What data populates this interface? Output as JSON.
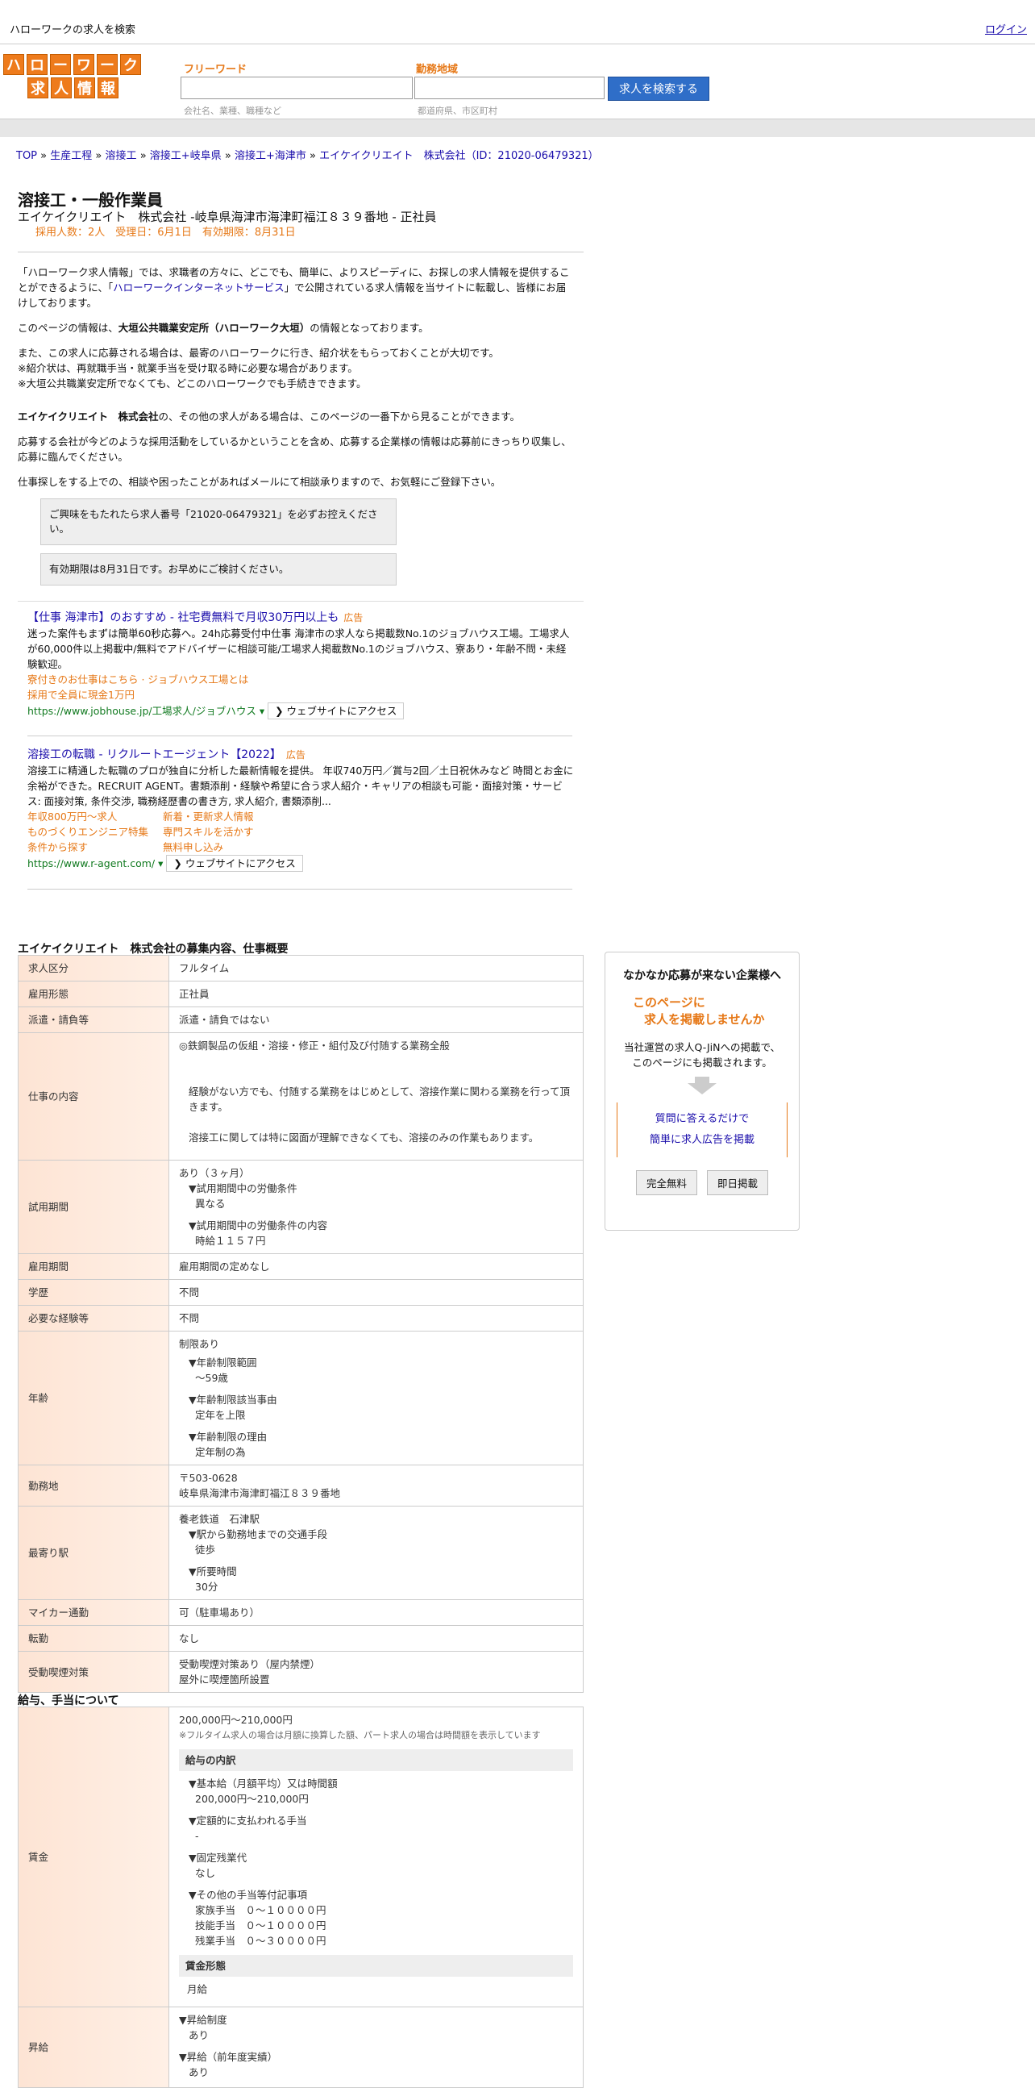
{
  "topbar": {
    "site_title": "ハローワークの求人を検索",
    "login": "ログイン"
  },
  "logo": {
    "row1": [
      "ハ",
      "ロ",
      "ー",
      "ワ",
      "ー",
      "ク"
    ],
    "row2": [
      "求",
      "人",
      "情",
      "報"
    ]
  },
  "search": {
    "freeword_label": "フリーワード",
    "freeword_hint": "会社名、業種、職種など",
    "area_label": "勤務地域",
    "area_hint": "都道府県、市区町村",
    "button": "求人を検索する"
  },
  "breadcrumb": {
    "items": [
      "TOP",
      "生産工程",
      "溶接工",
      "溶接工+岐阜県",
      "溶接工+海津市",
      "エイケイクリエイト　株式会社（ID：21020-06479321）"
    ],
    "sep": "»"
  },
  "job": {
    "title": "溶接工・一般作業員",
    "company_line": "エイケイクリエイト　株式会社 -岐阜県海津市海津町福江８３９番地 - 正社員",
    "meta": "採用人数：2人　受理日：6月1日　有効期限：8月31日"
  },
  "intro": {
    "p1a": "「ハローワーク求人情報」では、求職者の方々に、どこでも、簡単に、よりスピーディに、お探しの求人情報を提供することができるように、「",
    "p1_link": "ハローワークインターネットサービス",
    "p1b": "」で公開されている求人情報を当サイトに転載し、皆様にお届けしております。",
    "p2a": "このページの情報は、",
    "p2_bold": "大垣公共職業安定所（ハローワーク大垣）",
    "p2b": "の情報となっております。",
    "p3_1": "また、この求人に応募される場合は、最寄のハローワークに行き、紹介状をもらっておくことが大切です。",
    "p3_2": "※紹介状は、再就職手当・就業手当を受け取る時に必要な場合があります。",
    "p3_3": "※大垣公共職業安定所でなくても、どこのハローワークでも手続きできます。",
    "p4_bold": "エイケイクリエイト　株式会社",
    "p4": "の、その他の求人がある場合は、このページの一番下から見ることができます。",
    "p5": "応募する会社が今どのような採用活動をしているかということを含め、応募する企業様の情報は応募前にきっちり収集し、応募に臨んでください。",
    "p6": "仕事探しをする上での、相談や困ったことがあればメールにて相談承りますので、お気軽にご登録下さい。"
  },
  "notices": {
    "n1": "ご興味をもたれたら求人番号「21020-06479321」を必ずお控えください。",
    "n2": "有効期限は8月31日です。お早めにご検討ください。"
  },
  "ads": [
    {
      "title": "【仕事 海津市】のおすすめ - 社宅費無料で月収30万円以上も",
      "badge": "広告",
      "body": "迷った案件もまずは簡単60秒応募へ。24h応募受付中仕事 海津市の求人なら掲載数No.1のジョブハウス工場。工場求人が60,000件以上掲載中/無料でアドバイザーに相談可能/工場求人掲載数No.1のジョブハウス、寮あり・年齢不問・未経験歓迎。",
      "subs": [
        "寮付きのお仕事はこちら · ジョブハウス工場とは",
        "採用で全員に現金1万円"
      ],
      "url": "https://www.jobhouse.jp/工場求人/ジョブハウス ▾",
      "access": "❯ ウェブサイトにアクセス"
    },
    {
      "title": "溶接工の転職 - リクルートエージェント【2022】",
      "badge": "広告",
      "body": "溶接工に精通した転職のプロが独自に分析した最新情報を提供。 年収740万円／賞与2回／土日祝休みなど 時間とお金に余裕ができた。RECRUIT AGENT。書類添削・経験や希望に合う求人紹介・キャリアの相談も可能・面接対策・サービス: 面接対策, 条件交渉, 職務経歴書の書き方, 求人紹介, 書類添削...",
      "grid": [
        "年収800万円～求人",
        "新着・更新求人情報",
        "ものづくりエンジニア特集",
        "専門スキルを活かす",
        "条件から探す",
        "無料申し込み"
      ],
      "url": "https://www.r-agent.com/ ▾",
      "access": "❯ ウェブサイトにアクセス"
    }
  ],
  "overview": {
    "title": "エイケイクリエイト　株式会社の募集内容、仕事概要",
    "rows": {
      "kubun_k": "求人区分",
      "kubun_v": "フルタイム",
      "keitai_k": "雇用形態",
      "keitai_v": "正社員",
      "haken_k": "派遣・請負等",
      "haken_v": "派遣・請負ではない",
      "naiyo_k": "仕事の内容",
      "naiyo_v1": "◎鉄鋼製品の仮組・溶接・修正・組付及び付随する業務全般",
      "naiyo_v2": "経験がない方でも、付随する業務をはじめとして、溶接作業に関わる業務を行って頂きます。",
      "naiyo_v3": "溶接工に関しては特に図面が理解できなくても、溶接のみの作業もあります。",
      "shiyo_k": "試用期間",
      "shiyo_v1": "あり（３ヶ月）",
      "shiyo_v2": "▼試用期間中の労働条件",
      "shiyo_v3": "異なる",
      "shiyo_v4": "▼試用期間中の労働条件の内容",
      "shiyo_v5": "時給１１５７円",
      "koyo_k": "雇用期間",
      "koyo_v": "雇用期間の定めなし",
      "gaku_k": "学歴",
      "gaku_v": "不問",
      "keiken_k": "必要な経験等",
      "keiken_v": "不問",
      "nenrei_k": "年齢",
      "nenrei_v1": "制限あり",
      "nenrei_v2": "▼年齢制限範囲",
      "nenrei_v3": "〜59歳",
      "nenrei_v4": "▼年齢制限該当事由",
      "nenrei_v5": "定年を上限",
      "nenrei_v6": "▼年齢制限の理由",
      "nenrei_v7": "定年制の為",
      "kinmu_k": "勤務地",
      "kinmu_v1": "〒503-0628",
      "kinmu_v2": "岐阜県海津市海津町福江８３９番地",
      "eki_k": "最寄り駅",
      "eki_v1": "養老鉄道　石津駅",
      "eki_v2": "▼駅から勤務地までの交通手段",
      "eki_v3": "徒歩",
      "eki_v4": "▼所要時間",
      "eki_v5": "30分",
      "car_k": "マイカー通勤",
      "car_v": "可（駐車場あり）",
      "tenkin_k": "転勤",
      "tenkin_v": "なし",
      "kitsuen_k": "受動喫煙対策",
      "kitsuen_v1": "受動喫煙対策あり（屋内禁煙）",
      "kitsuen_v2": "屋外に喫煙箇所設置"
    }
  },
  "salary": {
    "title": "給与、手当について",
    "chingin_k": "賃金",
    "range": "200,000円〜210,000円",
    "note": "※フルタイム求人の場合は月額に換算した額、パート求人の場合は時間額を表示しています",
    "breakdown_head": "給与の内訳",
    "b1": "▼基本給（月額平均）又は時間額",
    "b1v": "200,000円〜210,000円",
    "b2": "▼定額的に支払われる手当",
    "b2v": "-",
    "b3": "▼固定残業代",
    "b3v": "なし",
    "b4": "▼その他の手当等付記事項",
    "b4v1": "家族手当　０～１００００円",
    "b4v2": "技能手当　０～１００００円",
    "b4v3": "残業手当　０～３００００円",
    "form_head": "賃金形態",
    "form_v": "月給",
    "shokyu_k": "昇給",
    "s1": "▼昇給制度",
    "s1v": "あり",
    "s2": "▼昇給（前年度実績）",
    "s2v": "あり"
  },
  "sidebox": {
    "title": "なかなか応募が来ない企業様へ",
    "orange1": "このページに",
    "orange2": "求人を掲載しませんか",
    "text1": "当社運営の求人Q-JiNへの掲載で、",
    "text2": "このページにも掲載されます。",
    "link1": "質問に答えるだけで",
    "link2": "簡単に求人広告を掲載",
    "btn1": "完全無料",
    "btn2": "即日掲載"
  },
  "colors": {
    "accent": "#e67817",
    "brand": "#ee7b1c",
    "button": "#2f6ec8",
    "link": "#1a0dab"
  }
}
